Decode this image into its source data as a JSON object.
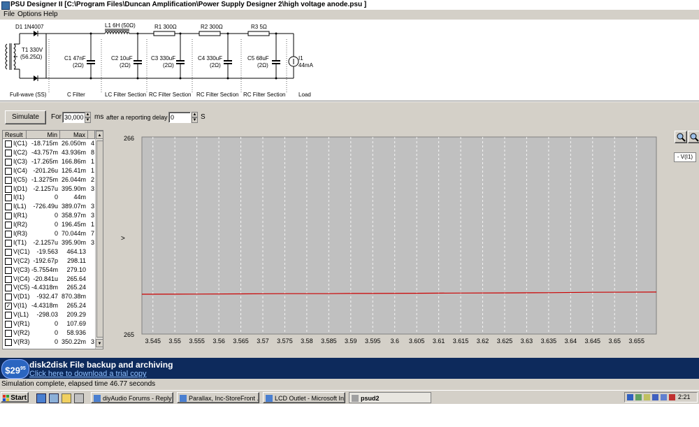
{
  "window": {
    "title": "PSU Designer II  [C:\\Program Files\\Duncan Amplification\\Power Supply Designer 2\\high voltage anode.psu ]"
  },
  "menu": [
    "File",
    "Options",
    "Help"
  ],
  "schematic": {
    "components": [
      {
        "label": "D1 1N4007"
      },
      {
        "label": "T1 330V",
        "sub": "(56.25Ω)"
      },
      {
        "label": "C1 47nF",
        "sub": "(2Ω)"
      },
      {
        "label": "L1 6H (50Ω)"
      },
      {
        "label": "C2 10uF",
        "sub": "(2Ω)"
      },
      {
        "label": "R1 300Ω"
      },
      {
        "label": "C3 330uF",
        "sub": "(2Ω)"
      },
      {
        "label": "R2 300Ω"
      },
      {
        "label": "C4 330uF",
        "sub": "(2Ω)"
      },
      {
        "label": "R3 5Ω"
      },
      {
        "label": "C5 68uF",
        "sub": "(2Ω)"
      },
      {
        "label": "I1",
        "sub": "44mA"
      }
    ],
    "sections": [
      "Full-wave (SS)",
      "C Filter",
      "LC Filter Section",
      "RC Filter Section",
      "RC Filter Section",
      "RC Filter Section",
      "Load"
    ]
  },
  "simulate": {
    "button": "Simulate",
    "for_label": "For",
    "duration": "30,000",
    "ms_label": "ms",
    "delay_label": "after a reporting delay of",
    "delay": "0",
    "s_label": "S"
  },
  "results": {
    "headers": [
      "Result",
      "Min",
      "Max"
    ],
    "rows": [
      {
        "name": "I(C1)",
        "min": "-18.715m",
        "max": "26.050m",
        "extra": "4",
        "checked": false
      },
      {
        "name": "I(C2)",
        "min": "-43.757m",
        "max": "43.936m",
        "extra": "8",
        "checked": false
      },
      {
        "name": "I(C3)",
        "min": "-17.265m",
        "max": "166.86m",
        "extra": "1",
        "checked": false
      },
      {
        "name": "I(C4)",
        "min": "-201.26u",
        "max": "126.41m",
        "extra": "1",
        "checked": false
      },
      {
        "name": "I(C5)",
        "min": "-1.3275m",
        "max": "26.044m",
        "extra": "2",
        "checked": false
      },
      {
        "name": "I(D1)",
        "min": "-2.1257u",
        "max": "395.90m",
        "extra": "3",
        "checked": false
      },
      {
        "name": "I(I1)",
        "min": "0",
        "max": "44m",
        "extra": "",
        "checked": false
      },
      {
        "name": "I(L1)",
        "min": "-726.49u",
        "max": "389.07m",
        "extra": "3",
        "checked": false
      },
      {
        "name": "I(R1)",
        "min": "0",
        "max": "358.97m",
        "extra": "3",
        "checked": false
      },
      {
        "name": "I(R2)",
        "min": "0",
        "max": "196.45m",
        "extra": "1",
        "checked": false
      },
      {
        "name": "I(R3)",
        "min": "0",
        "max": "70.044m",
        "extra": "7",
        "checked": false
      },
      {
        "name": "I(T1)",
        "min": "-2.1257u",
        "max": "395.90m",
        "extra": "3",
        "checked": false
      },
      {
        "name": "V(C1)",
        "min": "-19.563",
        "max": "464.13",
        "extra": "",
        "checked": false
      },
      {
        "name": "V(C2)",
        "min": "-192.67p",
        "max": "298.11",
        "extra": "",
        "checked": false
      },
      {
        "name": "V(C3)",
        "min": "-5.7554m",
        "max": "279.10",
        "extra": "",
        "checked": false
      },
      {
        "name": "V(C4)",
        "min": "-20.841u",
        "max": "265.64",
        "extra": "",
        "checked": false
      },
      {
        "name": "V(C5)",
        "min": "-4.4318m",
        "max": "265.24",
        "extra": "",
        "checked": false
      },
      {
        "name": "V(D1)",
        "min": "-932.47",
        "max": "870.38m",
        "extra": "",
        "checked": false
      },
      {
        "name": "V(I1)",
        "min": "-4.4318m",
        "max": "265.24",
        "extra": "",
        "checked": true
      },
      {
        "name": "V(L1)",
        "min": "-298.03",
        "max": "209.29",
        "extra": "",
        "checked": false
      },
      {
        "name": "V(R1)",
        "min": "0",
        "max": "107.69",
        "extra": "",
        "checked": false
      },
      {
        "name": "V(R2)",
        "min": "0",
        "max": "58.936",
        "extra": "",
        "checked": false
      },
      {
        "name": "V(R3)",
        "min": "0",
        "max": "350.22m",
        "extra": "3",
        "checked": false
      }
    ]
  },
  "chart_data": {
    "type": "line",
    "title": "",
    "xlabel": "",
    "ylabel": ">",
    "xlim": [
      3.5425,
      3.6595
    ],
    "ylim": [
      265,
      266
    ],
    "x_ticks": [
      "3.545",
      "3.55",
      "3.555",
      "3.56",
      "3.565",
      "3.57",
      "3.575",
      "3.58",
      "3.585",
      "3.59",
      "3.595",
      "3.6",
      "3.605",
      "3.61",
      "3.615",
      "3.62",
      "3.625",
      "3.63",
      "3.635",
      "3.64",
      "3.645",
      "3.65",
      "3.655"
    ],
    "y_ticks": [
      "266",
      "265"
    ],
    "grid": true,
    "legend": "V(I1)",
    "series": [
      {
        "name": "V(I1)",
        "color": "#cc0000",
        "x": [
          3.5425,
          3.555,
          3.565,
          3.575,
          3.585,
          3.59,
          3.595,
          3.605,
          3.615,
          3.625,
          3.635,
          3.645,
          3.6595
        ],
        "y": [
          265.202,
          265.203,
          265.204,
          265.205,
          265.205,
          265.206,
          265.206,
          265.207,
          265.208,
          265.209,
          265.21,
          265.212,
          265.213
        ]
      }
    ]
  },
  "zoom": {
    "legend_label": "- V(I1)"
  },
  "ad": {
    "price": "$29",
    "cents": "95",
    "headline": "disk2disk File backup and archiving",
    "link": "Click here to download a trial copy"
  },
  "status": "Simulation complete, elapsed time 46.77 seconds",
  "taskbar": {
    "start": "Start",
    "tasks": [
      "diyAudio Forums - Reply ...",
      "Parallax, Inc-StoreFront ...",
      "LCD Outlet - Microsoft In...",
      "psud2"
    ],
    "clock": "2:21"
  }
}
